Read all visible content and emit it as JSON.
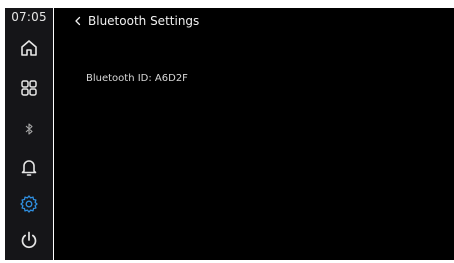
{
  "status": {
    "time": "07:05"
  },
  "sidebar": {
    "items": [
      {
        "icon": "home-icon",
        "active": false
      },
      {
        "icon": "apps-grid-icon",
        "active": false
      },
      {
        "icon": "bluetooth-icon",
        "active": false
      },
      {
        "icon": "bell-icon",
        "active": false
      },
      {
        "icon": "gear-icon",
        "active": true
      },
      {
        "icon": "power-icon",
        "active": false
      }
    ]
  },
  "header": {
    "back_icon": "chevron-left-icon",
    "title": "Bluetooth Settings"
  },
  "content": {
    "bluetooth_id": "Bluetooth ID: A6D2F"
  },
  "colors": {
    "sidebar_bg": "#151518",
    "main_bg": "#000000",
    "icon": "#e6e6e6",
    "icon_muted": "#a8a8a8",
    "accent": "#2f8fe0"
  }
}
